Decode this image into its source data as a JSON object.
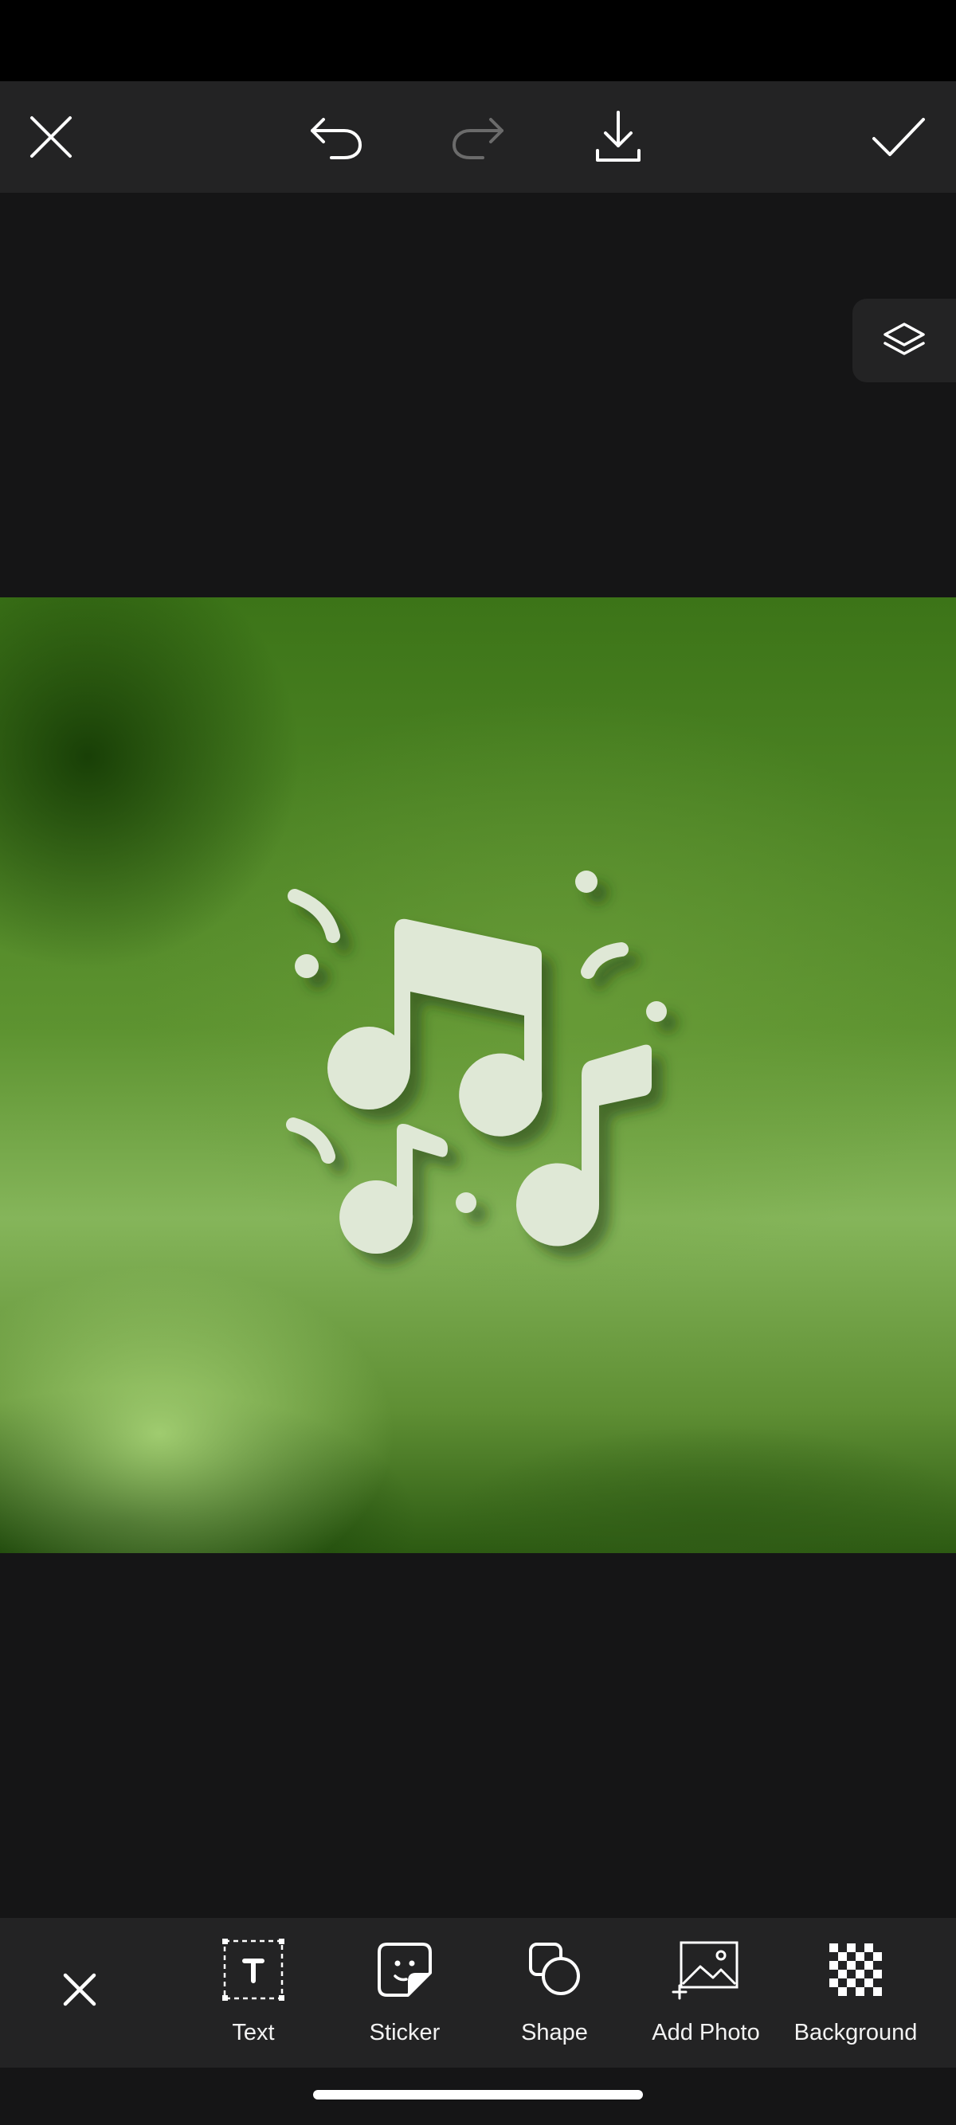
{
  "top_toolbar": {
    "close_icon": "close-icon",
    "undo_icon": "undo-icon",
    "redo_icon": "redo-icon",
    "download_icon": "download-icon",
    "confirm_icon": "checkmark-icon"
  },
  "layers_icon": "layers-icon",
  "canvas": {
    "image": "music-notes-on-green-gradient"
  },
  "bottom_toolbar": {
    "close_icon": "close-icon",
    "tools": [
      {
        "label": "Text",
        "icon": "text-icon"
      },
      {
        "label": "Sticker",
        "icon": "sticker-icon"
      },
      {
        "label": "Shape",
        "icon": "shape-icon"
      },
      {
        "label": "Add Photo",
        "icon": "add-photo-icon"
      },
      {
        "label": "Background",
        "icon": "background-icon"
      }
    ]
  },
  "colors": {
    "status_bar": "#000000",
    "toolbar": "#232324",
    "workspace": "#151516",
    "icon": "#ffffff",
    "icon_disabled": "#6b6b6b"
  }
}
